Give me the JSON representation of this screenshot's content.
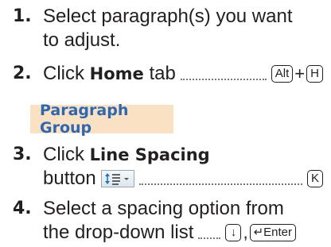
{
  "steps": [
    {
      "number": "1.",
      "line1": "Select paragraph(s) you want",
      "line2": "to adjust."
    },
    {
      "number": "2.",
      "text_before": "Click",
      "bold": "Home",
      "text_after": "tab",
      "keys": [
        "Alt",
        "H"
      ],
      "key_joiner": "+"
    },
    {
      "number": "3.",
      "text_before": "Click",
      "bold": "Line Spacing",
      "line2": "button",
      "icon": "line-spacing-icon",
      "keys": [
        "K"
      ]
    },
    {
      "number": "4.",
      "line1": "Select a spacing option from",
      "line2": "the drop-down list",
      "keys": [
        "↓",
        "↵Enter"
      ],
      "key_joiner": ","
    }
  ],
  "group_label": "Paragraph Group",
  "colors": {
    "group_bg": "#fbe1c3",
    "group_text": "#2c67b1",
    "text": "#231f20"
  }
}
